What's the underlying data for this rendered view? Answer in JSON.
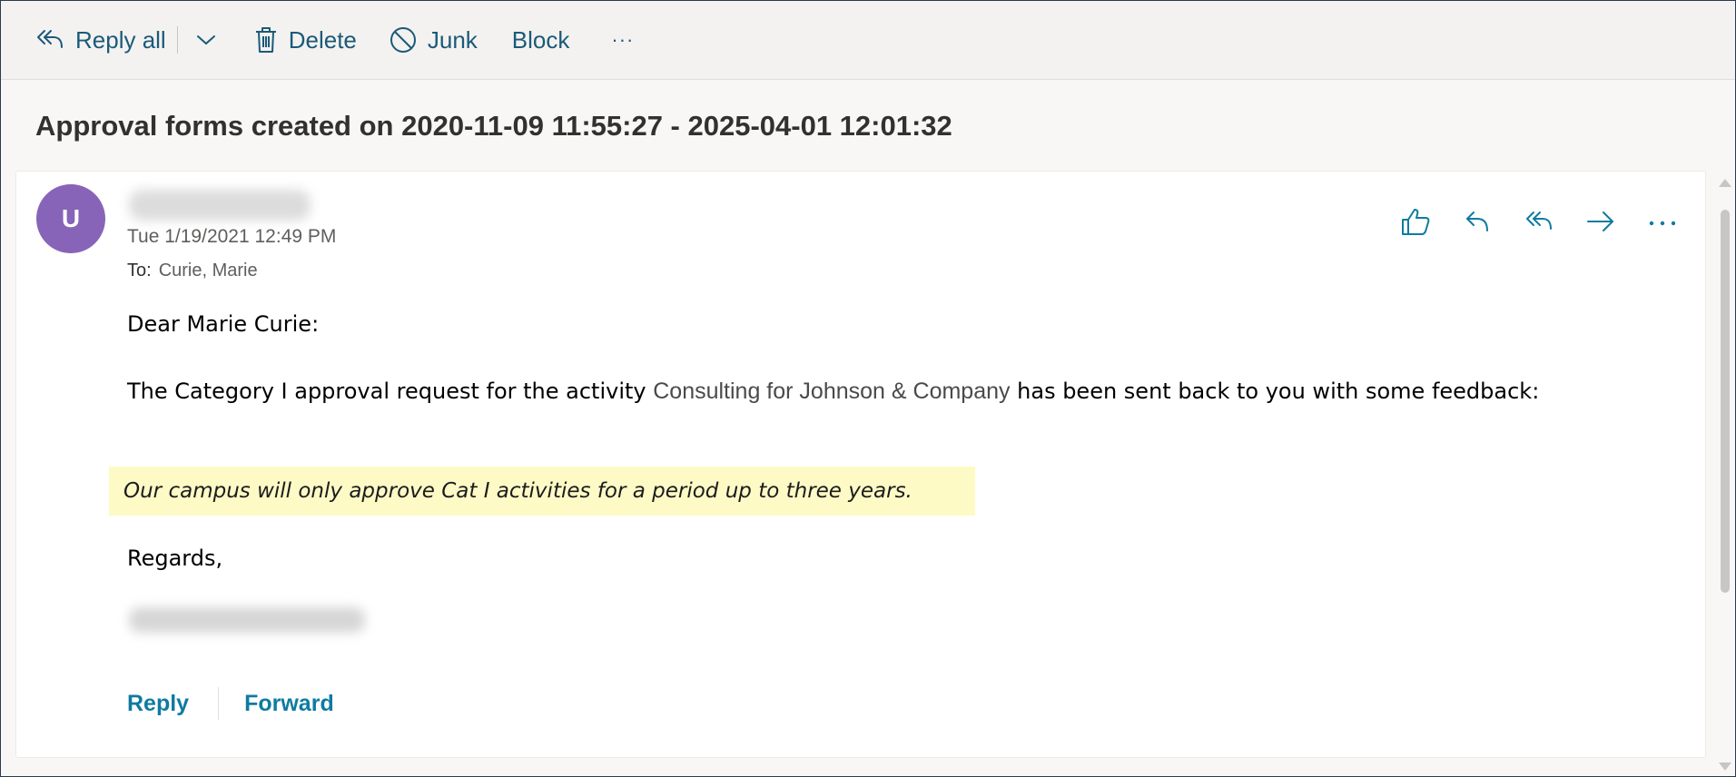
{
  "toolbar": {
    "reply_all_label": "Reply all",
    "delete_label": "Delete",
    "junk_label": "Junk",
    "block_label": "Block",
    "more_label": "···"
  },
  "email": {
    "subject": "Approval forms created on 2020-11-09 11:55:27 - 2025-04-01 12:01:32",
    "avatar_initial": "U",
    "avatar_color": "#8764b8",
    "datetime": "Tue 1/19/2021 12:49 PM",
    "to_label": "To:",
    "to_name": "Curie, Marie",
    "actions": [
      "like-icon",
      "reply-icon",
      "reply-all-icon",
      "forward-icon",
      "more-icon"
    ],
    "greeting": "Dear Marie Curie:",
    "body_prefix": "The Category I approval request for the activity ",
    "activity_name": "Consulting for Johnson & Company",
    "body_suffix": " has been sent back to you with some feedback:",
    "feedback": "Our campus will only approve Cat I activities for a period up to three years.",
    "closing": "Regards,"
  },
  "footer": {
    "reply_label": "Reply",
    "forward_label": "Forward"
  },
  "colors": {
    "accent": "#0e7ba0",
    "toolbar_text": "#1b5a78",
    "highlight": "#fdfac6"
  }
}
